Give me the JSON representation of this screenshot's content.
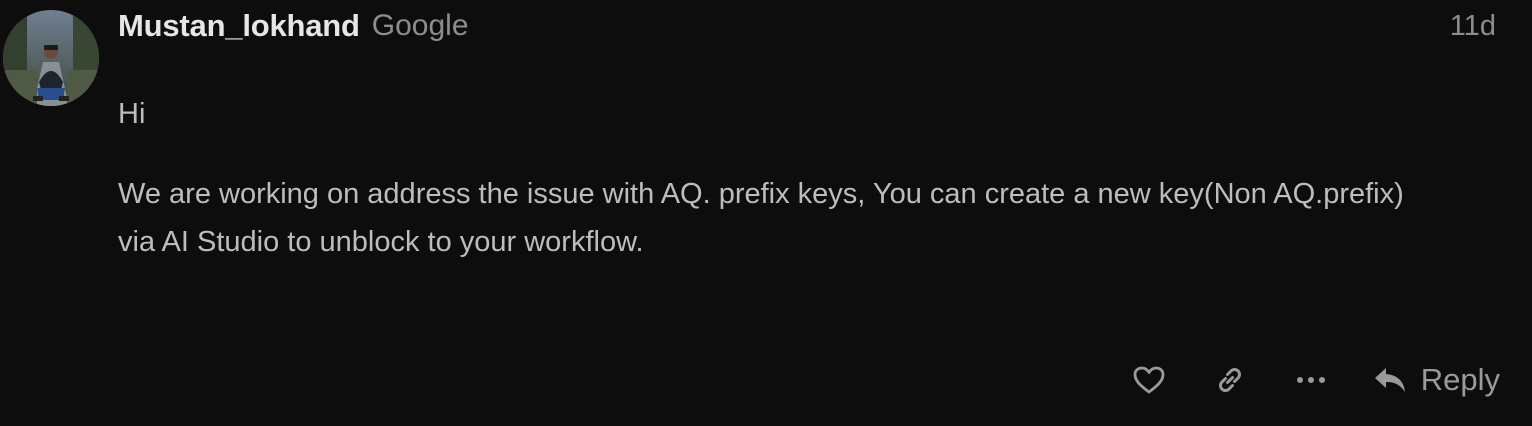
{
  "post": {
    "username": "Mustan_lokhand",
    "group": "Google",
    "date": "11d",
    "paragraphs": [
      "Hi",
      "We are working on address the issue with AQ. prefix keys, You can create a new key(Non AQ.prefix) via AI Studio to unblock to your workflow."
    ]
  },
  "actions": {
    "like_icon": "heart-icon",
    "share_icon": "link-icon",
    "more_icon": "ellipsis-icon",
    "reply_icon": "reply-arrow-icon",
    "reply_label": "Reply"
  },
  "colors": {
    "background": "#0d0d0d",
    "username": "#e6e6e6",
    "muted": "#8d8d8d",
    "body_text": "#bdbdbd"
  }
}
